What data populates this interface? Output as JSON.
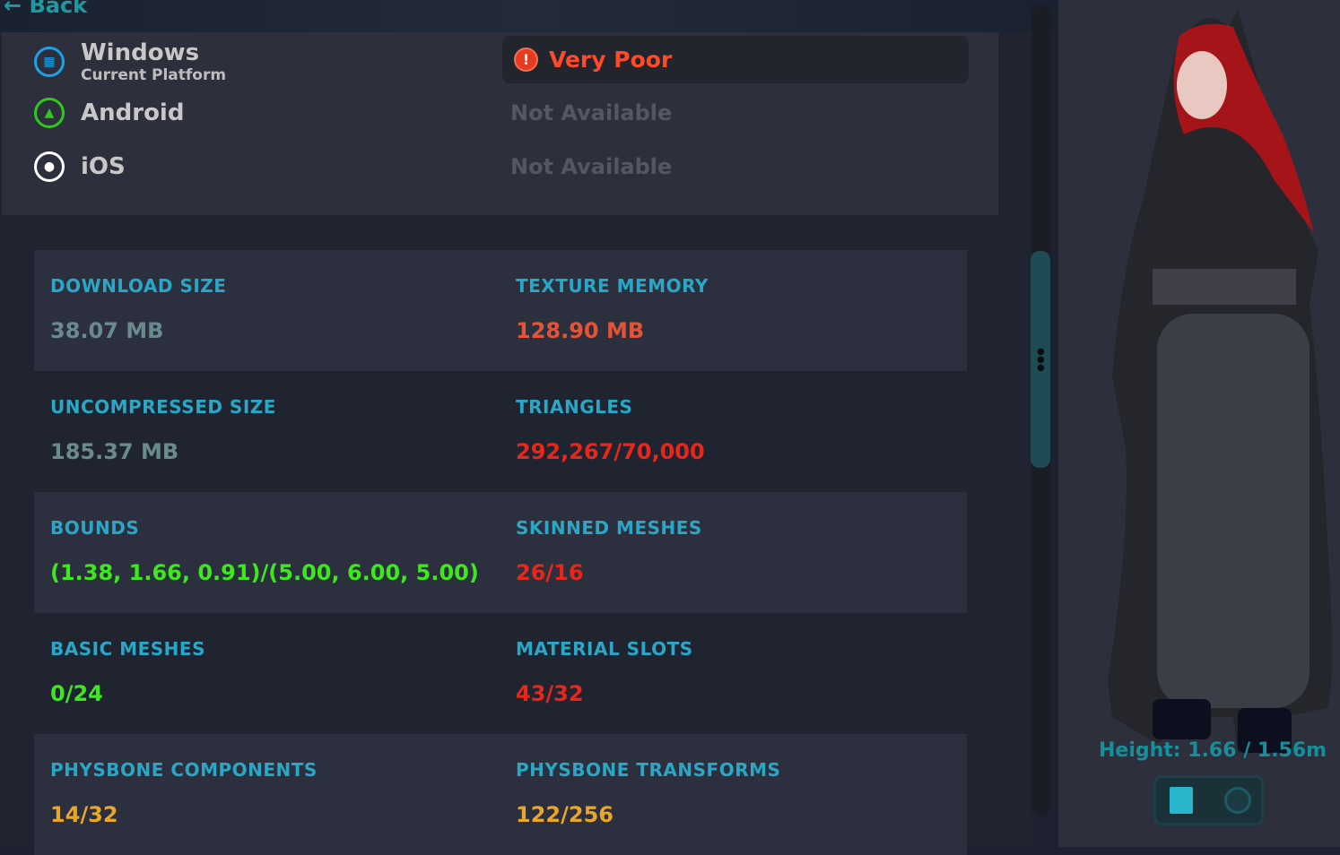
{
  "nav": {
    "back_label": "Back"
  },
  "platforms": [
    {
      "name": "Windows",
      "subtitle": "Current Platform",
      "icon": "windows-icon",
      "color": "#1aa3e8",
      "status": "Very Poor",
      "status_icon": "exclamation-icon"
    },
    {
      "name": "Android",
      "icon": "android-icon",
      "color": "#2ec81e",
      "status": "Not Available"
    },
    {
      "name": "iOS",
      "icon": "apple-icon",
      "color": "#ffffff",
      "status": "Not Available"
    }
  ],
  "stats": [
    {
      "label": "DOWNLOAD SIZE",
      "value": "38.07 MB",
      "color": "#6a8a8e"
    },
    {
      "label": "TEXTURE MEMORY",
      "value": "128.90 MB",
      "color": "#e0553a"
    },
    {
      "label": "UNCOMPRESSED SIZE",
      "value": "185.37 MB",
      "color": "#6a8a8e"
    },
    {
      "label": "TRIANGLES",
      "value": "292,267/70,000",
      "color": "#e8261a"
    },
    {
      "label": "BOUNDS",
      "value": "(1.38, 1.66, 0.91)/(5.00, 6.00, 5.00)",
      "color": "#3ee81f"
    },
    {
      "label": "SKINNED MESHES",
      "value": "26/16",
      "color": "#e8261a"
    },
    {
      "label": "BASIC MESHES",
      "value": "0/24",
      "color": "#3ee81f"
    },
    {
      "label": "MATERIAL SLOTS",
      "value": "43/32",
      "color": "#e8261a"
    },
    {
      "label": "PHYSBONE COMPONENTS",
      "value": "14/32",
      "color": "#e8a72a"
    },
    {
      "label": "PHYSBONE TRANSFORMS",
      "value": "122/256",
      "color": "#e8a72a"
    }
  ],
  "preview": {
    "height_text": "Height: 1.66 / 1.56m",
    "buttons": [
      "avatar-details-icon",
      "emoji-icon"
    ]
  }
}
